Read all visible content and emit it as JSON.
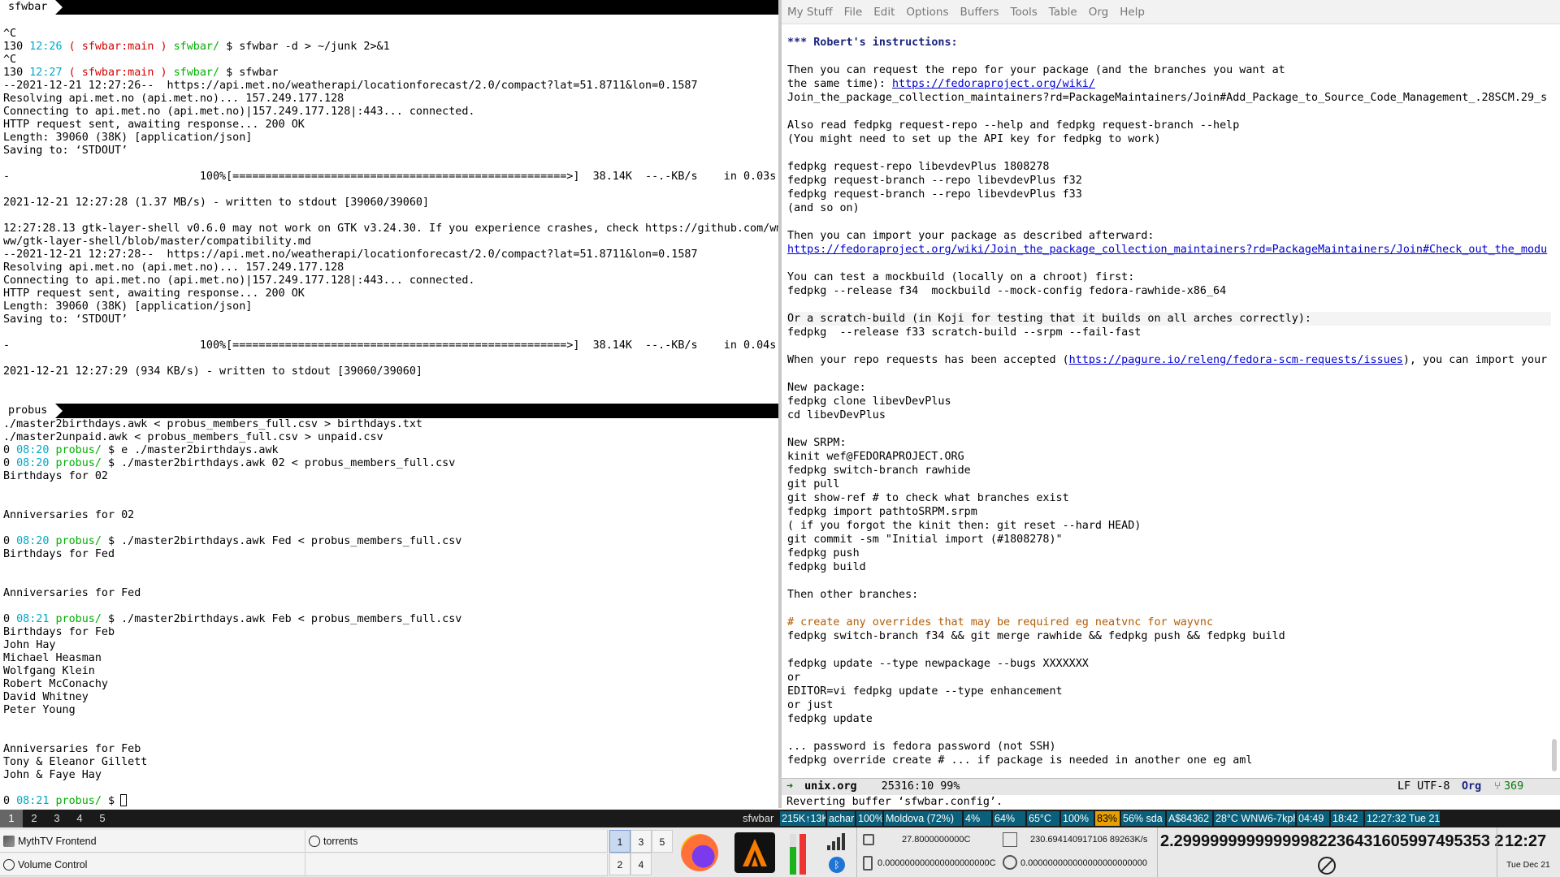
{
  "top_terminal": {
    "tab": "sfwbar",
    "lines": [
      [
        {
          "t": ""
        }
      ],
      [
        {
          "t": "^C"
        }
      ],
      [
        {
          "t": "130 "
        },
        {
          "t": "12:26",
          "c": "cyan"
        },
        {
          "t": " ( sfwbar:main ) ",
          "c": "red"
        },
        {
          "t": "sfwbar/",
          "c": "grn"
        },
        {
          "t": " $ sfwbar -d > ~/junk 2>&1"
        }
      ],
      [
        {
          "t": "^C"
        }
      ],
      [
        {
          "t": "130 "
        },
        {
          "t": "12:27",
          "c": "cyan"
        },
        {
          "t": " ( sfwbar:main ) ",
          "c": "red"
        },
        {
          "t": "sfwbar/",
          "c": "grn"
        },
        {
          "t": " $ sfwbar"
        }
      ],
      [
        {
          "t": "--2021-12-21 12:27:26--  https://api.met.no/weatherapi/locationforecast/2.0/compact?lat=51.8711&lon=0.1587"
        }
      ],
      [
        {
          "t": "Resolving api.met.no (api.met.no)... 157.249.177.128"
        }
      ],
      [
        {
          "t": "Connecting to api.met.no (api.met.no)|157.249.177.128|:443... connected."
        }
      ],
      [
        {
          "t": "HTTP request sent, awaiting response... 200 OK"
        }
      ],
      [
        {
          "t": "Length: 39060 (38K) [application/json]"
        }
      ],
      [
        {
          "t": "Saving to: ‘STDOUT’"
        }
      ],
      [
        {
          "t": ""
        }
      ],
      [
        {
          "t": "-                             100%[===================================================>]  38.14K  --.-KB/s    in 0.03s"
        }
      ],
      [
        {
          "t": ""
        }
      ],
      [
        {
          "t": "2021-12-21 12:27:28 (1.37 MB/s) - written to stdout [39060/39060]"
        }
      ],
      [
        {
          "t": ""
        }
      ],
      [
        {
          "t": "12:27:28.13 gtk-layer-shell v0.6.0 may not work on GTK v3.24.30. If you experience crashes, check https://github.com/wm"
        }
      ],
      [
        {
          "t": "ww/gtk-layer-shell/blob/master/compatibility.md"
        }
      ],
      [
        {
          "t": "--2021-12-21 12:27:28--  https://api.met.no/weatherapi/locationforecast/2.0/compact?lat=51.8711&lon=0.1587"
        }
      ],
      [
        {
          "t": "Resolving api.met.no (api.met.no)... 157.249.177.128"
        }
      ],
      [
        {
          "t": "Connecting to api.met.no (api.met.no)|157.249.177.128|:443... connected."
        }
      ],
      [
        {
          "t": "HTTP request sent, awaiting response... 200 OK"
        }
      ],
      [
        {
          "t": "Length: 39060 (38K) [application/json]"
        }
      ],
      [
        {
          "t": "Saving to: ‘STDOUT’"
        }
      ],
      [
        {
          "t": ""
        }
      ],
      [
        {
          "t": "-                             100%[===================================================>]  38.14K  --.-KB/s    in 0.04s"
        }
      ],
      [
        {
          "t": ""
        }
      ],
      [
        {
          "t": "2021-12-21 12:27:29 (934 KB/s) - written to stdout [39060/39060]"
        }
      ]
    ]
  },
  "bottom_terminal": {
    "tab": "probus",
    "lines": [
      [
        {
          "t": "./master2birthdays.awk < probus_members_full.csv > birthdays.txt"
        }
      ],
      [
        {
          "t": "./master2unpaid.awk < probus_members_full.csv > unpaid.csv"
        }
      ],
      [
        {
          "t": "0 "
        },
        {
          "t": "08:20",
          "c": "cyan"
        },
        {
          "t": " probus/",
          "c": "grn"
        },
        {
          "t": " $ e ./master2birthdays.awk"
        }
      ],
      [
        {
          "t": "0 "
        },
        {
          "t": "08:20",
          "c": "cyan"
        },
        {
          "t": " probus/",
          "c": "grn"
        },
        {
          "t": " $ ./master2birthdays.awk 02 < probus_members_full.csv"
        }
      ],
      [
        {
          "t": "Birthdays for 02"
        }
      ],
      [
        {
          "t": ""
        }
      ],
      [
        {
          "t": ""
        }
      ],
      [
        {
          "t": "Anniversaries for 02"
        }
      ],
      [
        {
          "t": ""
        }
      ],
      [
        {
          "t": "0 "
        },
        {
          "t": "08:20",
          "c": "cyan"
        },
        {
          "t": " probus/",
          "c": "grn"
        },
        {
          "t": " $ ./master2birthdays.awk Fed < probus_members_full.csv"
        }
      ],
      [
        {
          "t": "Birthdays for Fed"
        }
      ],
      [
        {
          "t": ""
        }
      ],
      [
        {
          "t": ""
        }
      ],
      [
        {
          "t": "Anniversaries for Fed"
        }
      ],
      [
        {
          "t": ""
        }
      ],
      [
        {
          "t": "0 "
        },
        {
          "t": "08:21",
          "c": "cyan"
        },
        {
          "t": " probus/",
          "c": "grn"
        },
        {
          "t": " $ ./master2birthdays.awk Feb < probus_members_full.csv"
        }
      ],
      [
        {
          "t": "Birthdays for Feb"
        }
      ],
      [
        {
          "t": "John Hay"
        }
      ],
      [
        {
          "t": "Michael Heasman"
        }
      ],
      [
        {
          "t": "Wolfgang Klein"
        }
      ],
      [
        {
          "t": "Robert McConachy"
        }
      ],
      [
        {
          "t": "David Whitney"
        }
      ],
      [
        {
          "t": "Peter Young"
        }
      ],
      [
        {
          "t": ""
        }
      ],
      [
        {
          "t": ""
        }
      ],
      [
        {
          "t": "Anniversaries for Feb"
        }
      ],
      [
        {
          "t": "Tony & Eleanor Gillett"
        }
      ],
      [
        {
          "t": "John & Faye Hay"
        }
      ],
      [
        {
          "t": ""
        }
      ],
      [
        {
          "t": "0 "
        },
        {
          "t": "08:21",
          "c": "cyan"
        },
        {
          "t": " probus/",
          "c": "grn"
        },
        {
          "t": " $ "
        }
      ]
    ]
  },
  "emacs": {
    "menu": [
      "My Stuff",
      "File",
      "Edit",
      "Options",
      "Buffers",
      "Tools",
      "Table",
      "Org",
      "Help"
    ],
    "lines": [
      [
        {
          "t": "*** Robert's instructions:",
          "c": "heading"
        }
      ],
      [
        {
          "t": ""
        }
      ],
      [
        {
          "t": "Then you can request the repo for your package (and the branches you want at"
        }
      ],
      [
        {
          "t": "the same time): "
        },
        {
          "t": "https://fedoraproject.org/wiki/",
          "c": "link"
        }
      ],
      [
        {
          "t": "Join_the_package_collection_maintainers?rd=PackageMaintainers/Join#Add_Package_to_Source_Code_Management_.28SCM.29_s"
        }
      ],
      [
        {
          "t": ""
        }
      ],
      [
        {
          "t": "Also read fedpkg request-repo --help and fedpkg request-branch --help"
        }
      ],
      [
        {
          "t": "(You might need to set up the API key for fedpkg to work)"
        }
      ],
      [
        {
          "t": ""
        }
      ],
      [
        {
          "t": "fedpkg request-repo libevdevPlus 1808278"
        }
      ],
      [
        {
          "t": "fedpkg request-branch --repo libevdevPlus f32"
        }
      ],
      [
        {
          "t": "fedpkg request-branch --repo libevdevPlus f33"
        }
      ],
      [
        {
          "t": "(and so on)"
        }
      ],
      [
        {
          "t": ""
        }
      ],
      [
        {
          "t": "Then you can import your package as described afterward:"
        }
      ],
      [
        {
          "t": "https://fedoraproject.org/wiki/Join_the_package_collection_maintainers?rd=PackageMaintainers/Join#Check_out_the_modu",
          "c": "link"
        }
      ],
      [
        {
          "t": ""
        }
      ],
      [
        {
          "t": "You can test a mockbuild (locally on a chroot) first:"
        }
      ],
      [
        {
          "t": "fedpkg --release f34  mockbuild --mock-config fedora-rawhide-x86_64"
        }
      ],
      [
        {
          "t": ""
        }
      ],
      [
        {
          "t": "Or a scratch-build (in Koji for testing that it builds on all arches correctly):",
          "c": "hl"
        }
      ],
      [
        {
          "t": "fedpkg  --release f33 scratch-build --srpm --fail-fast"
        }
      ],
      [
        {
          "t": ""
        }
      ],
      [
        {
          "t": "When your repo requests has been accepted ("
        },
        {
          "t": "https://pagure.io/releng/fedora-scm-requests/issues",
          "c": "link"
        },
        {
          "t": "), you can import your"
        }
      ],
      [
        {
          "t": ""
        }
      ],
      [
        {
          "t": "New package:"
        }
      ],
      [
        {
          "t": "fedpkg clone libevDevPlus"
        }
      ],
      [
        {
          "t": "cd libevDevPlus"
        }
      ],
      [
        {
          "t": ""
        }
      ],
      [
        {
          "t": "New SRPM:"
        }
      ],
      [
        {
          "t": "kinit wef@FEDORAPROJECT.ORG"
        }
      ],
      [
        {
          "t": "fedpkg switch-branch rawhide"
        }
      ],
      [
        {
          "t": "git pull"
        }
      ],
      [
        {
          "t": "git show-ref # to check what branches exist"
        }
      ],
      [
        {
          "t": "fedpkg import pathtoSRPM.srpm"
        }
      ],
      [
        {
          "t": "( if you forgot the kinit then: git reset --hard HEAD)"
        }
      ],
      [
        {
          "t": "git commit -sm \"Initial import (#1808278)\""
        }
      ],
      [
        {
          "t": "fedpkg push"
        }
      ],
      [
        {
          "t": "fedpkg build"
        }
      ],
      [
        {
          "t": ""
        }
      ],
      [
        {
          "t": "Then other branches:"
        }
      ],
      [
        {
          "t": ""
        }
      ],
      [
        {
          "t": "# create any overrides that may be required eg neatvnc for wayvnc",
          "c": "comment"
        }
      ],
      [
        {
          "t": "fedpkg switch-branch f34 && git merge rawhide && fedpkg push && fedpkg build"
        }
      ],
      [
        {
          "t": ""
        }
      ],
      [
        {
          "t": "fedpkg update --type newpackage --bugs XXXXXXX"
        }
      ],
      [
        {
          "t": "or"
        }
      ],
      [
        {
          "t": "EDITOR=vi fedpkg update --type enhancement"
        }
      ],
      [
        {
          "t": "or just"
        }
      ],
      [
        {
          "t": "fedpkg update"
        }
      ],
      [
        {
          "t": ""
        }
      ],
      [
        {
          "t": "... password is fedora password (not SSH)"
        }
      ],
      [
        {
          "t": "fedpkg override create # ... if package is needed in another one eg aml"
        }
      ]
    ],
    "modeline": {
      "buffer": "unix.org",
      "position": "25316:10 99%",
      "encoding": "LF UTF-8",
      "mode": "Org",
      "vc": "369"
    },
    "echo": "Reverting buffer ‘sfwbar.config’."
  },
  "wsbar": {
    "workspaces": [
      "1",
      "2",
      "3",
      "4",
      "5"
    ],
    "active": "1",
    "title": "sfwbar",
    "status": [
      {
        "t": "215K↑13K",
        "bg": "#0a5f7a"
      },
      {
        "t": "achar",
        "bg": "#0a5f7a"
      },
      {
        "t": "100%",
        "bg": "#0a5f7a"
      },
      {
        "t": "Moldova (72%)",
        "bg": "#0a5f7a"
      },
      {
        "t": "4%",
        "bg": "#0a5f7a"
      },
      {
        "t": "64%",
        "bg": "#0a5f7a"
      },
      {
        "t": "65°C",
        "bg": "#0a5f7a"
      },
      {
        "t": "100%",
        "bg": "#0a5f7a"
      },
      {
        "t": "83%",
        "bg": "#e8a000",
        "fg": "#000"
      },
      {
        "t": "56% sda",
        "bg": "#0a5f7a"
      },
      {
        "t": "A$84362",
        "bg": "#0a5f7a"
      },
      {
        "t": "28°C WNW6-7kph",
        "bg": "#0a5f7a"
      },
      {
        "t": "04:49",
        "bg": "#0a5f7a"
      },
      {
        "t": "18:42",
        "bg": "#0a5f7a"
      },
      {
        "t": "12:27:32 Tue 21",
        "bg": "#0a5f7a"
      }
    ]
  },
  "taskbar": {
    "tasks": [
      {
        "label": "MythTV Frontend",
        "icon": "mythtv-icon"
      },
      {
        "label": "torrents",
        "icon": "no-entry-icon"
      },
      {
        "label": "Volume Control",
        "icon": "no-entry-icon"
      }
    ],
    "pager": [
      "1",
      "3",
      "5",
      "2",
      "4"
    ],
    "pager_active": "1",
    "sensor1": "27.8000000000C",
    "sensor2": "230.694140917106 89263K/s",
    "sensor3": "0.000000000000000000000C",
    "sensor4": "0.000000000000000000000000",
    "big_number": "2.29999999999999982236431605997495353 2",
    "clock_time": "12:27",
    "clock_date": "Tue Dec 21"
  }
}
